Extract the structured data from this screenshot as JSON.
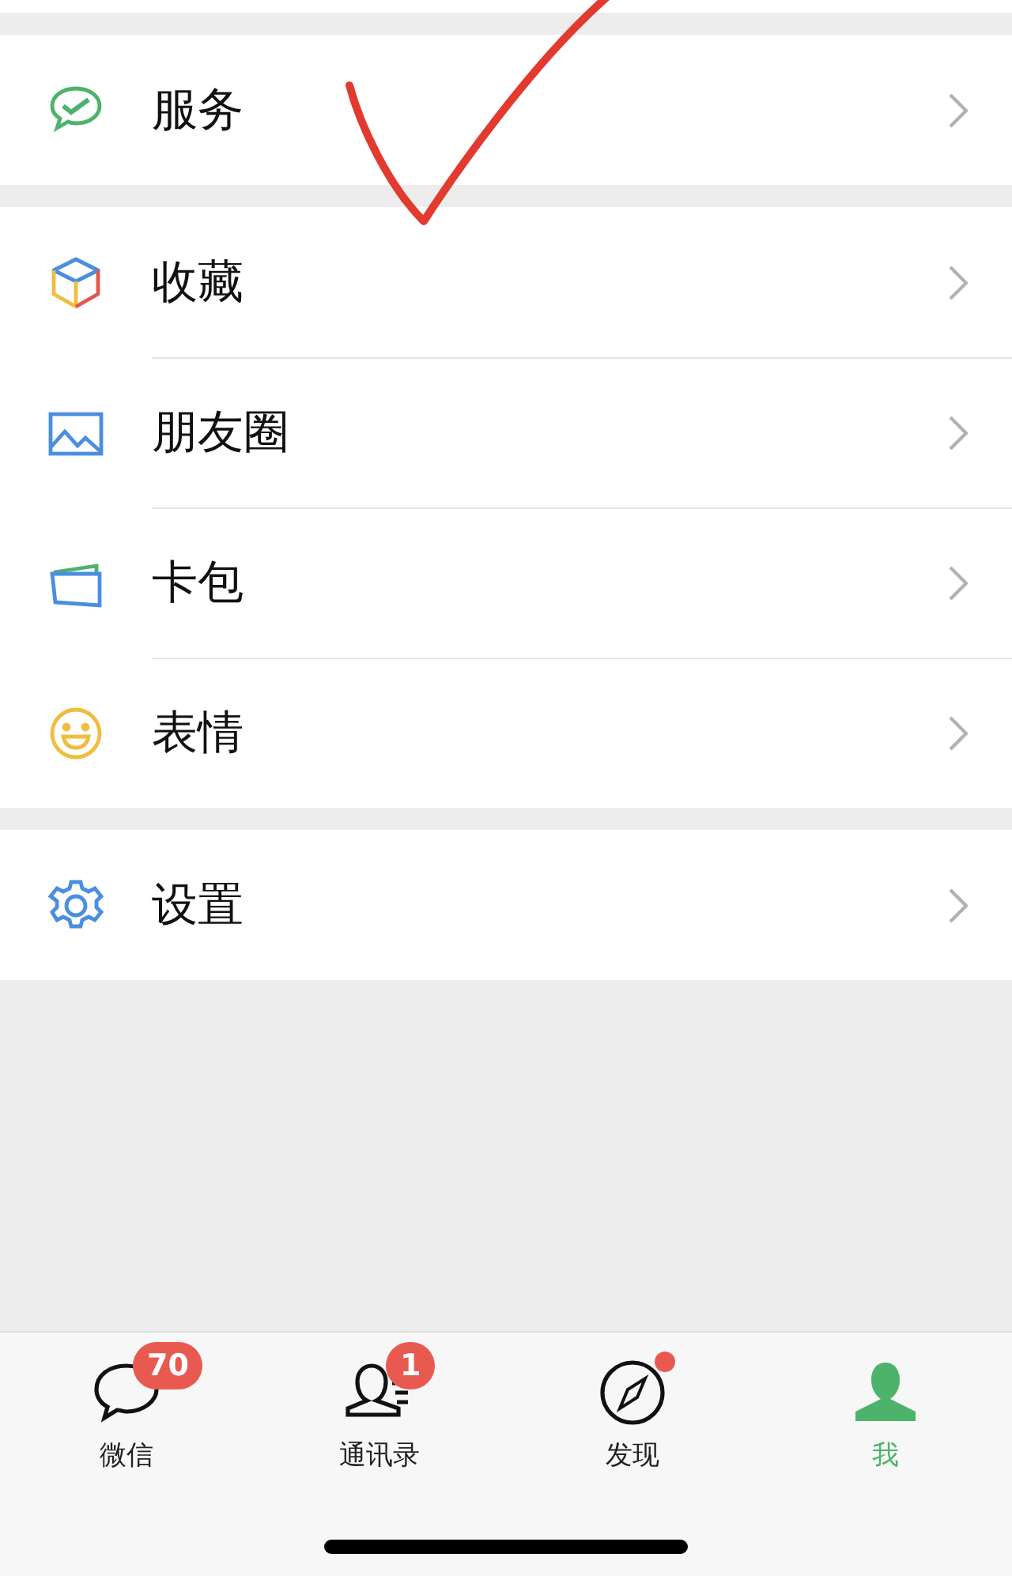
{
  "menu_groups": [
    {
      "items": [
        {
          "kind": "pay",
          "label": "服务"
        }
      ]
    },
    {
      "items": [
        {
          "kind": "cube",
          "label": "收藏"
        },
        {
          "kind": "image",
          "label": "朋友圈"
        },
        {
          "kind": "wallet",
          "label": "卡包"
        },
        {
          "kind": "smile",
          "label": "表情"
        }
      ]
    },
    {
      "items": [
        {
          "kind": "gear",
          "label": "设置"
        }
      ]
    }
  ],
  "tabs": [
    {
      "kind": "chat",
      "label": "微信",
      "badge": "70",
      "dot": false,
      "selected": false
    },
    {
      "kind": "contacts",
      "label": "通讯录",
      "badge": "1",
      "dot": false,
      "selected": false
    },
    {
      "kind": "compass",
      "label": "发现",
      "dot": true,
      "selected": false
    },
    {
      "kind": "person",
      "label": "我",
      "dot": false,
      "selected": true
    }
  ]
}
